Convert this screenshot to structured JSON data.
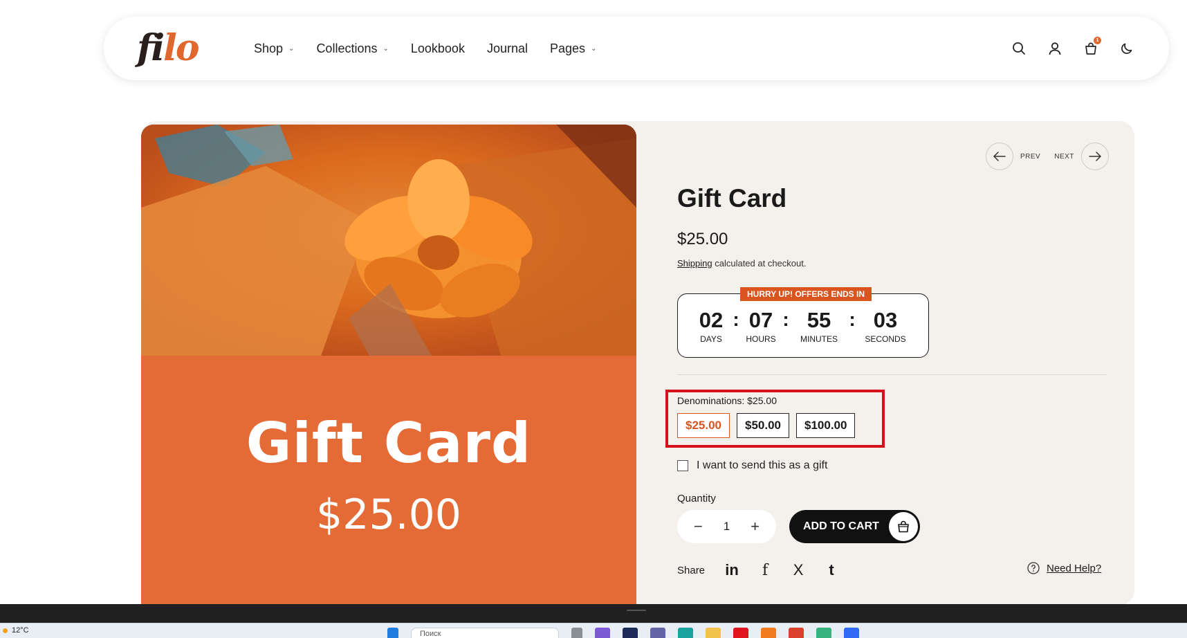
{
  "header": {
    "logo_part1": "fi",
    "logo_part2": "lo",
    "nav": [
      {
        "label": "Shop",
        "has_dropdown": true
      },
      {
        "label": "Collections",
        "has_dropdown": true
      },
      {
        "label": "Lookbook",
        "has_dropdown": false
      },
      {
        "label": "Journal",
        "has_dropdown": false
      },
      {
        "label": "Pages",
        "has_dropdown": true
      }
    ],
    "icons": [
      "search-icon",
      "account-icon",
      "cart-icon",
      "dark-mode-icon"
    ],
    "cart_count": "1"
  },
  "media": {
    "card_title": "Gift Card",
    "card_price": "$25.00",
    "card_color": "#e46a36"
  },
  "pager": {
    "prev_label": "PREV",
    "next_label": "NEXT"
  },
  "product": {
    "title": "Gift Card",
    "price": "$25.00",
    "shipping_link": "Shipping",
    "shipping_text": " calculated at checkout."
  },
  "countdown": {
    "badge": "HURRY UP! OFFERS ENDS IN",
    "days": "02",
    "hours": "07",
    "minutes": "55",
    "seconds": "03",
    "days_label": "DAYS",
    "hours_label": "HOURS",
    "minutes_label": "MINUTES",
    "seconds_label": "SECONDS",
    "sep": ":"
  },
  "denominations": {
    "label": "Denominations: $25.00",
    "options": [
      "$25.00",
      "$50.00",
      "$100.00"
    ],
    "selected": "$25.00"
  },
  "gift": {
    "label": "I want to send this as a gift"
  },
  "quantity": {
    "label": "Quantity",
    "value": "1",
    "minus": "−",
    "plus": "+"
  },
  "add_to_cart": {
    "label": "ADD TO CART"
  },
  "share": {
    "label": "Share",
    "networks": [
      {
        "name": "linkedin",
        "glyph": "in"
      },
      {
        "name": "facebook",
        "glyph": "f"
      },
      {
        "name": "x",
        "glyph": "X"
      },
      {
        "name": "tumblr",
        "glyph": "t"
      }
    ]
  },
  "help": {
    "label": "Need Help?"
  },
  "taskbar": {
    "weather": "12°C",
    "search_placeholder": "Поиск"
  },
  "colors": {
    "accent": "#d9541e",
    "highlight_border": "#d6101a",
    "product_bg": "#f4f1ec"
  }
}
